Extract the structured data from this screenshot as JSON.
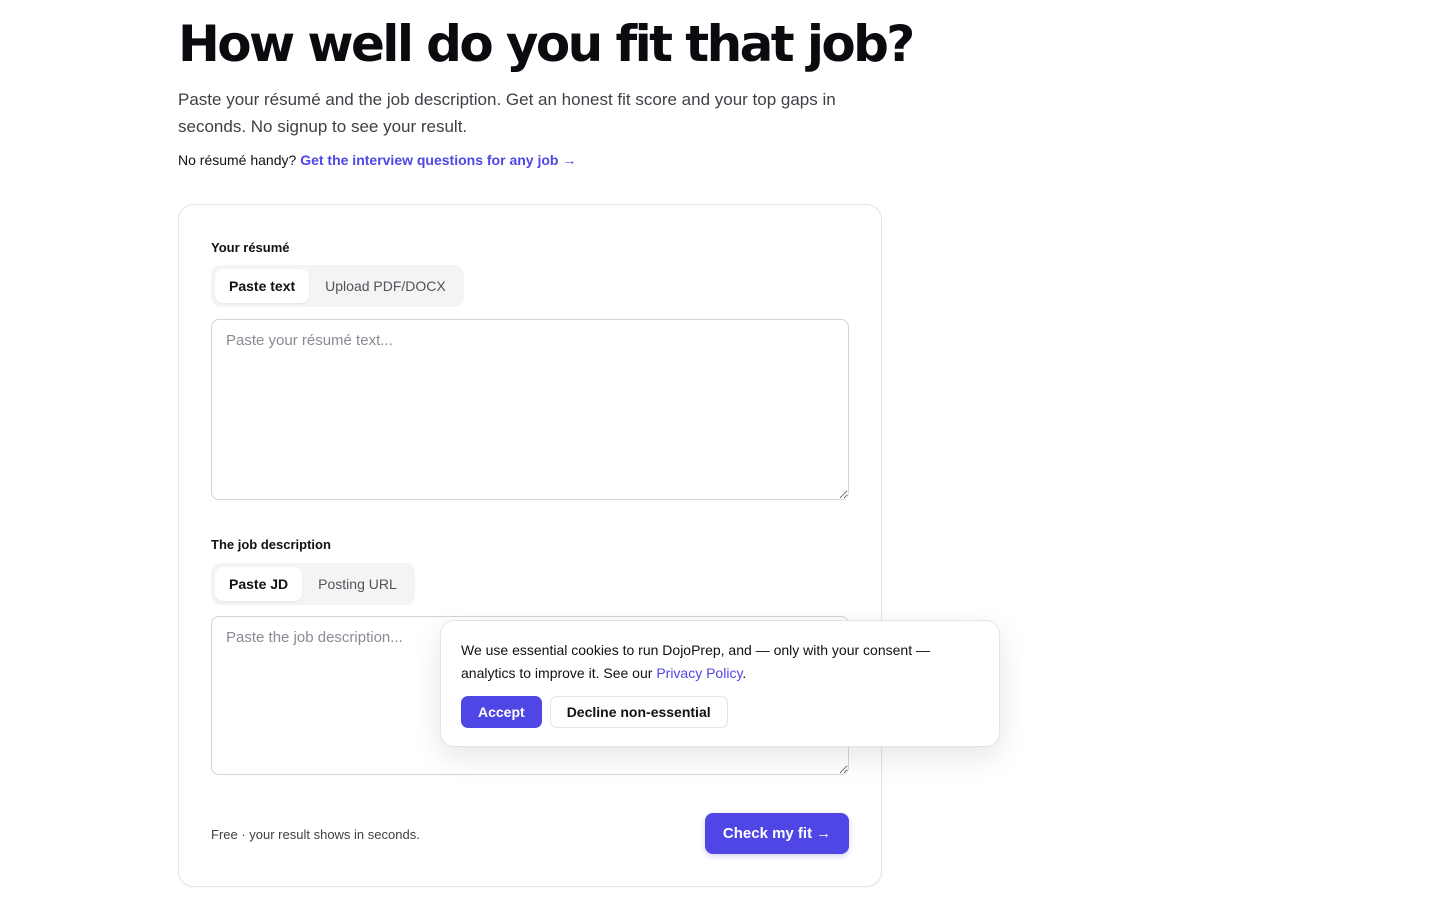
{
  "hero": {
    "title": "How well do you fit that job?",
    "subtitle": "Paste your résumé and the job description. Get an honest fit score and your top gaps in seconds. No signup to see your result.",
    "alt_prompt": "No résumé handy?",
    "alt_link": "Get the interview questions for any job",
    "alt_link_arrow": "→"
  },
  "form": {
    "resume": {
      "label": "Your résumé",
      "tabs": [
        {
          "label": "Paste text",
          "active": true
        },
        {
          "label": "Upload PDF/DOCX",
          "active": false
        }
      ],
      "placeholder": "Paste your résumé text..."
    },
    "job": {
      "label": "The job description",
      "tabs": [
        {
          "label": "Paste JD",
          "active": true
        },
        {
          "label": "Posting URL",
          "active": false
        }
      ],
      "placeholder": "Paste the job description..."
    },
    "footer_note": "Free · your result shows in seconds.",
    "submit_label": "Check my fit",
    "submit_arrow": "→"
  },
  "cookie_banner": {
    "text": "We use essential cookies to run DojoPrep, and — only with your consent — analytics to improve it. See our",
    "link": "Privacy Policy",
    "text_end": ".",
    "accept_label": "Accept",
    "decline_label": "Decline non-essential"
  },
  "colors": {
    "accent": "#4f46e5",
    "text": "#111111",
    "muted": "#3f3f46",
    "border": "#e4e4e7"
  }
}
